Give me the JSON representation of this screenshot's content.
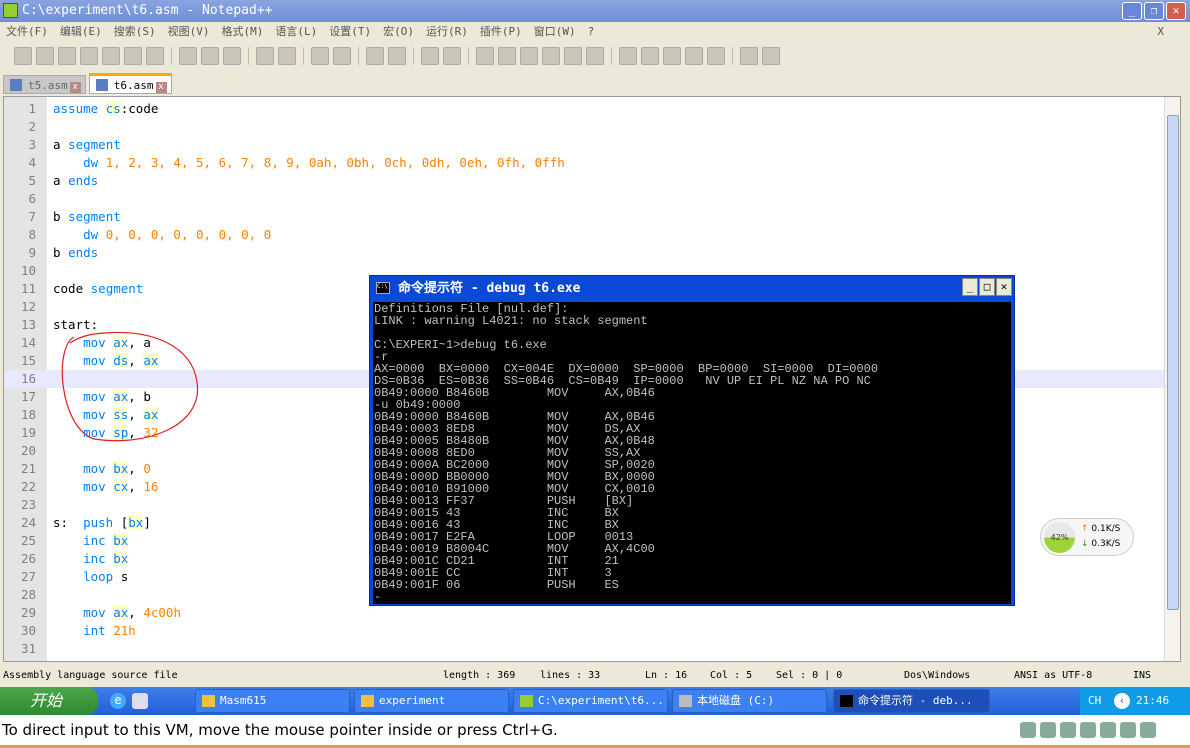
{
  "window": {
    "title": "C:\\experiment\\t6.asm - Notepad++",
    "close_x": "X"
  },
  "menu": [
    "文件(F)",
    "编辑(E)",
    "搜索(S)",
    "视图(V)",
    "格式(M)",
    "语言(L)",
    "设置(T)",
    "宏(O)",
    "运行(R)",
    "插件(P)",
    "窗口(W)",
    "?"
  ],
  "tabs": [
    {
      "label": "t5.asm",
      "active": false
    },
    {
      "label": "t6.asm",
      "active": true
    }
  ],
  "editor": {
    "current_line": 16,
    "lines": [
      [
        [
          "assume ",
          "k"
        ],
        [
          "cs",
          "r"
        ],
        [
          ":code",
          "p"
        ]
      ],
      [],
      [
        [
          "a ",
          "p"
        ],
        [
          "segment",
          "k"
        ]
      ],
      [
        [
          "    dw ",
          "k"
        ],
        [
          "1, 2, 3, 4, 5, 6, 7, 8, 9, 0ah, 0bh, 0ch, 0dh, 0eh, 0fh, 0ffh",
          "n"
        ]
      ],
      [
        [
          "a ",
          "p"
        ],
        [
          "ends",
          "k"
        ]
      ],
      [],
      [
        [
          "b ",
          "p"
        ],
        [
          "segment",
          "k"
        ]
      ],
      [
        [
          "    dw ",
          "k"
        ],
        [
          "0, 0, 0, 0, 0, 0, 0, 0",
          "n"
        ]
      ],
      [
        [
          "b ",
          "p"
        ],
        [
          "ends",
          "k"
        ]
      ],
      [],
      [
        [
          "code ",
          "p"
        ],
        [
          "segment",
          "k"
        ]
      ],
      [],
      [
        [
          "start:",
          "p"
        ]
      ],
      [
        [
          "    mov ",
          "k"
        ],
        [
          "ax",
          "r"
        ],
        [
          ", a",
          "p"
        ]
      ],
      [
        [
          "    mov ",
          "k"
        ],
        [
          "ds",
          "r"
        ],
        [
          ", ",
          "p"
        ],
        [
          "ax",
          "r"
        ]
      ],
      [],
      [
        [
          "    mov ",
          "k"
        ],
        [
          "ax",
          "r"
        ],
        [
          ", b",
          "p"
        ]
      ],
      [
        [
          "    mov ",
          "k"
        ],
        [
          "ss",
          "r"
        ],
        [
          ", ",
          "p"
        ],
        [
          "ax",
          "r"
        ]
      ],
      [
        [
          "    mov ",
          "k"
        ],
        [
          "sp",
          "r"
        ],
        [
          ", ",
          "p"
        ],
        [
          "32",
          "n"
        ]
      ],
      [],
      [
        [
          "    mov ",
          "k"
        ],
        [
          "bx",
          "r"
        ],
        [
          ", ",
          "p"
        ],
        [
          "0",
          "n"
        ]
      ],
      [
        [
          "    mov ",
          "k"
        ],
        [
          "cx",
          "r"
        ],
        [
          ", ",
          "p"
        ],
        [
          "16",
          "n"
        ]
      ],
      [],
      [
        [
          "s:  ",
          "p"
        ],
        [
          "push ",
          "k"
        ],
        [
          "[",
          "p"
        ],
        [
          "bx",
          "r"
        ],
        [
          "]",
          "p"
        ]
      ],
      [
        [
          "    inc ",
          "k"
        ],
        [
          "bx",
          "r"
        ]
      ],
      [
        [
          "    inc ",
          "k"
        ],
        [
          "bx",
          "r"
        ]
      ],
      [
        [
          "    loop ",
          "k"
        ],
        [
          "s",
          "p"
        ]
      ],
      [],
      [
        [
          "    mov ",
          "k"
        ],
        [
          "ax",
          "r"
        ],
        [
          ", ",
          "p"
        ],
        [
          "4c00h",
          "n"
        ]
      ],
      [
        [
          "    int ",
          "k"
        ],
        [
          "21h",
          "n"
        ]
      ],
      []
    ]
  },
  "status": {
    "file_type": "Assembly language source file",
    "length": "length : 369",
    "lines": "lines : 33",
    "ln": "Ln : 16",
    "col": "Col : 5",
    "sel": "Sel : 0 | 0",
    "eol": "Dos\\Windows",
    "encoding": "ANSI as UTF-8",
    "mode": "INS"
  },
  "cmd": {
    "title": "命令提示符 - debug t6.exe",
    "output": "Definitions File [nul.def]:\nLINK : warning L4021: no stack segment\n\nC:\\EXPERI~1>debug t6.exe\n-r\nAX=0000  BX=0000  CX=004E  DX=0000  SP=0000  BP=0000  SI=0000  DI=0000\nDS=0B36  ES=0B36  SS=0B46  CS=0B49  IP=0000   NV UP EI PL NZ NA PO NC\n0B49:0000 B8460B        MOV     AX,0B46\n-u 0b49:0000\n0B49:0000 B8460B        MOV     AX,0B46\n0B49:0003 8ED8          MOV     DS,AX\n0B49:0005 B8480B        MOV     AX,0B48\n0B49:0008 8ED0          MOV     SS,AX\n0B49:000A BC2000        MOV     SP,0020\n0B49:000D BB0000        MOV     BX,0000\n0B49:0010 B91000        MOV     CX,0010\n0B49:0013 FF37          PUSH    [BX]\n0B49:0015 43            INC     BX\n0B49:0016 43            INC     BX\n0B49:0017 E2FA          LOOP    0013\n0B49:0019 B8004C        MOV     AX,4C00\n0B49:001C CD21          INT     21\n0B49:001E CC            INT     3\n0B49:001F 06            PUSH    ES\n-"
  },
  "netmon": {
    "percent": "42%",
    "percent_value": 42,
    "up": "0.1K/S",
    "down": "0.3K/S"
  },
  "taskbar": {
    "start": "开始",
    "tasks": [
      "Masm615",
      "experiment",
      "C:\\experiment\\t6...",
      "本地磁盘 (C:)",
      "命令提示符 - deb..."
    ],
    "lang": "CH",
    "clock": "21:46"
  },
  "vm": {
    "hint": "To direct input to this VM, move the mouse pointer inside or press Ctrl+G."
  },
  "colors": {
    "keyword": "#0080ff",
    "number": "#ff8000",
    "annotation": "#e02020",
    "console_bg": "#000000"
  }
}
